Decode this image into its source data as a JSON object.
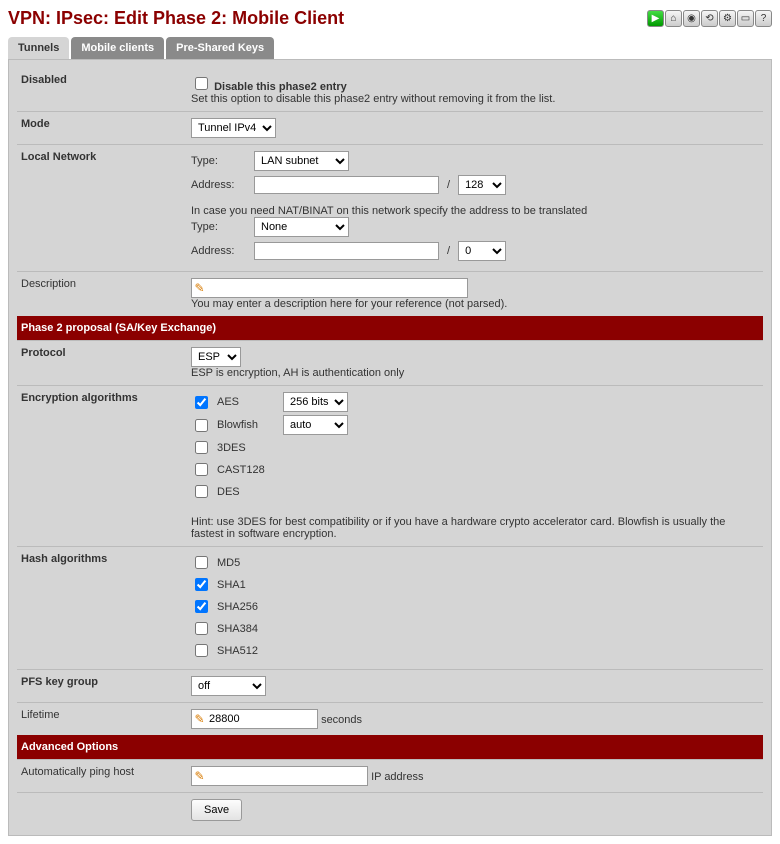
{
  "title": "VPN: IPsec: Edit Phase 2: Mobile Client",
  "tabs": [
    {
      "label": "Tunnels",
      "active": true
    },
    {
      "label": "Mobile clients",
      "active": false
    },
    {
      "label": "Pre-Shared Keys",
      "active": false
    }
  ],
  "disabled": {
    "label": "Disabled",
    "cb_label": "Disable this phase2 entry",
    "hint": "Set this option to disable this phase2 entry without removing it from the list."
  },
  "mode": {
    "label": "Mode",
    "value": "Tunnel IPv4"
  },
  "local_network": {
    "label": "Local Network",
    "type_label": "Type:",
    "type_value": "LAN subnet",
    "addr_label": "Address:",
    "addr_value": "",
    "cidr_value": "128",
    "nat_hint": "In case you need NAT/BINAT on this network specify the address to be translated",
    "nat_type_label": "Type:",
    "nat_type_value": "None",
    "nat_addr_label": "Address:",
    "nat_addr_value": "",
    "nat_cidr_value": "0"
  },
  "description": {
    "label": "Description",
    "value": "",
    "hint": "You may enter a description here for your reference (not parsed)."
  },
  "phase2_header": "Phase 2 proposal (SA/Key Exchange)",
  "protocol": {
    "label": "Protocol",
    "value": "ESP",
    "hint": "ESP is encryption, AH is authentication only"
  },
  "encryption": {
    "label": "Encryption algorithms",
    "algos": [
      {
        "name": "AES",
        "checked": true,
        "select": "256 bits"
      },
      {
        "name": "Blowfish",
        "checked": false,
        "select": "auto"
      },
      {
        "name": "3DES",
        "checked": false
      },
      {
        "name": "CAST128",
        "checked": false
      },
      {
        "name": "DES",
        "checked": false
      }
    ],
    "hint": "Hint: use 3DES for best compatibility or if you have a hardware crypto accelerator card. Blowfish is usually the fastest in software encryption."
  },
  "hash": {
    "label": "Hash algorithms",
    "algos": [
      {
        "name": "MD5",
        "checked": false
      },
      {
        "name": "SHA1",
        "checked": true
      },
      {
        "name": "SHA256",
        "checked": true
      },
      {
        "name": "SHA384",
        "checked": false
      },
      {
        "name": "SHA512",
        "checked": false
      }
    ]
  },
  "pfs": {
    "label": "PFS key group",
    "value": "off"
  },
  "lifetime": {
    "label": "Lifetime",
    "value": "28800",
    "suffix": "seconds"
  },
  "advanced_header": "Advanced Options",
  "autoping": {
    "label": "Automatically ping host",
    "value": "",
    "suffix": "IP address"
  },
  "save_label": "Save"
}
